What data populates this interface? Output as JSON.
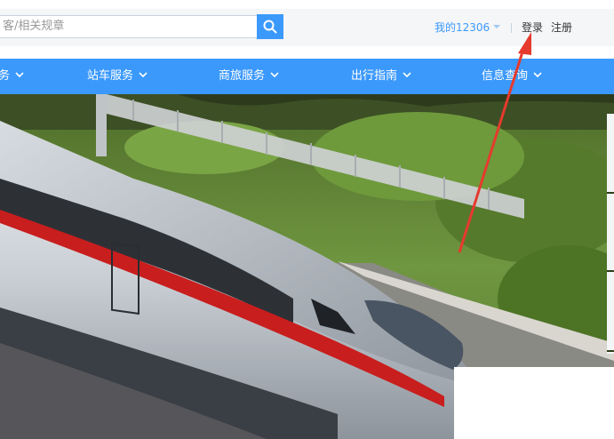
{
  "header": {
    "search": {
      "placeholder": "搜索车票、餐饮、常旅客/相关规章",
      "visible_text": "客/相关规章"
    },
    "my12306": "我的12306",
    "login": "登录",
    "register": "注册"
  },
  "nav": {
    "items": [
      {
        "label": "务"
      },
      {
        "label": "站车服务"
      },
      {
        "label": "商旅服务"
      },
      {
        "label": "出行指南"
      },
      {
        "label": "信息查询"
      }
    ]
  },
  "colors": {
    "brand_blue": "#3b99fc",
    "annotation_red": "#e63a2e"
  },
  "icons": {
    "search": "search-icon",
    "dropdown": "chevron-down-icon",
    "annotation": "red-arrow-annotation"
  }
}
